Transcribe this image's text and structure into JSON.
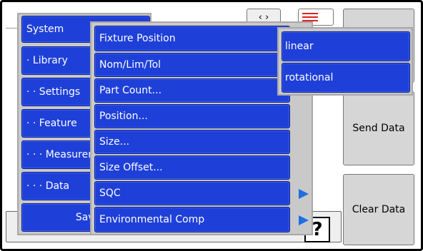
{
  "menu_level1": {
    "items": [
      {
        "label": "System"
      },
      {
        "label": "· Library"
      },
      {
        "label": "· · Settings"
      },
      {
        "label": "· · Feature"
      },
      {
        "label": "· · · Measurement"
      },
      {
        "label": "· · · Data"
      },
      {
        "label": "Save"
      }
    ]
  },
  "menu_level2": {
    "items": [
      {
        "label": "Fixture Position"
      },
      {
        "label": "Nom/Lim/Tol"
      },
      {
        "label": "Part Count..."
      },
      {
        "label": "Position..."
      },
      {
        "label": "Size..."
      },
      {
        "label": "Size Offset..."
      },
      {
        "label": "SQC"
      },
      {
        "label": "Environmental Comp"
      }
    ]
  },
  "menu_level3": {
    "items": [
      {
        "label": "linear"
      },
      {
        "label": "rotational"
      }
    ]
  },
  "right_panel": {
    "send_data_label": "Send Data",
    "clear_data_label": "Clear Data"
  },
  "help_icon_glyph": "?",
  "colors": {
    "menu_item_bg": "#1f40d8",
    "menu_panel_bg": "#c9c9c9",
    "arrow": "#1f6fe0"
  },
  "icons": [
    "nav-arrows-icon",
    "cursor-marker-icon",
    "help-icon",
    "submenu-arrow-icon"
  ]
}
